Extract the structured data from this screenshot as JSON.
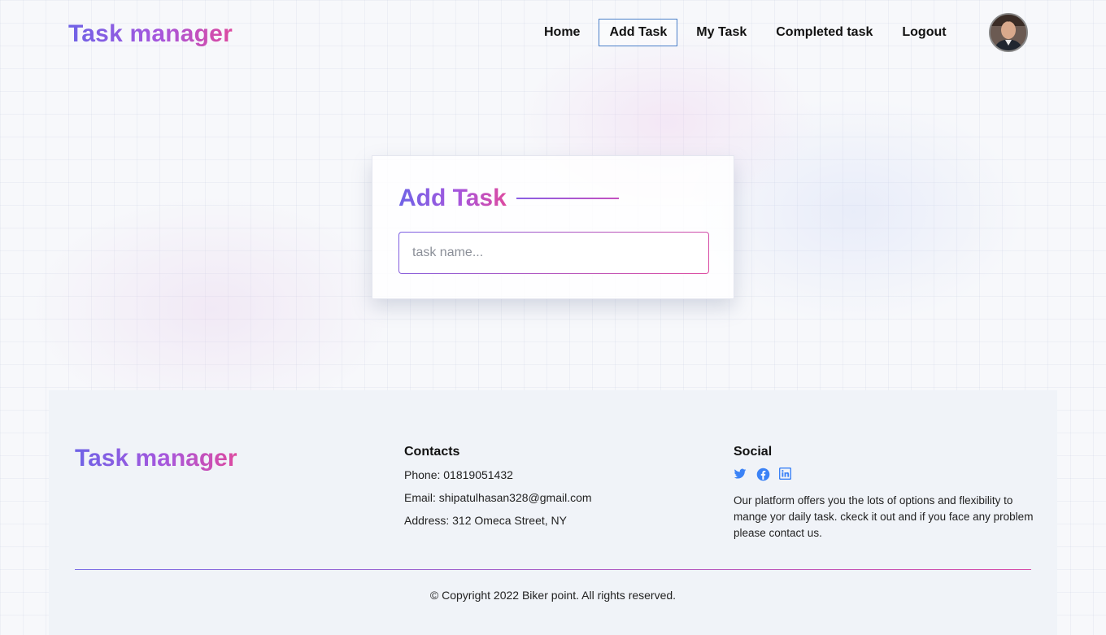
{
  "header": {
    "brand": "Task manager",
    "nav": [
      {
        "label": "Home",
        "active": false
      },
      {
        "label": "Add Task",
        "active": true
      },
      {
        "label": "My Task",
        "active": false
      },
      {
        "label": "Completed task",
        "active": false
      },
      {
        "label": "Logout",
        "active": false
      }
    ],
    "avatar_icon": "user-avatar"
  },
  "add_task": {
    "title": "Add Task",
    "input_placeholder": "task name...",
    "input_value": ""
  },
  "footer": {
    "brand": "Task manager",
    "contacts": {
      "title": "Contacts",
      "phone": "Phone: 01819051432",
      "email": "Email: shipatulhasan328@gmail.com",
      "address": "Address: 312 Omeca Street, NY"
    },
    "social": {
      "title": "Social",
      "icons": [
        "twitter-icon",
        "facebook-icon",
        "linkedin-icon"
      ],
      "text": "Our platform offers you the lots of options and flexibility to mange yor daily task. ckeck it out and if you face any problem please contact us."
    },
    "copyright": "© Copyright 2022 Biker point. All rights reserved."
  },
  "colors": {
    "gradient_start": "#6f63e6",
    "gradient_end": "#dd4aa0",
    "social_icon": "#3b82f6",
    "active_nav_border": "#4a7fc8"
  }
}
